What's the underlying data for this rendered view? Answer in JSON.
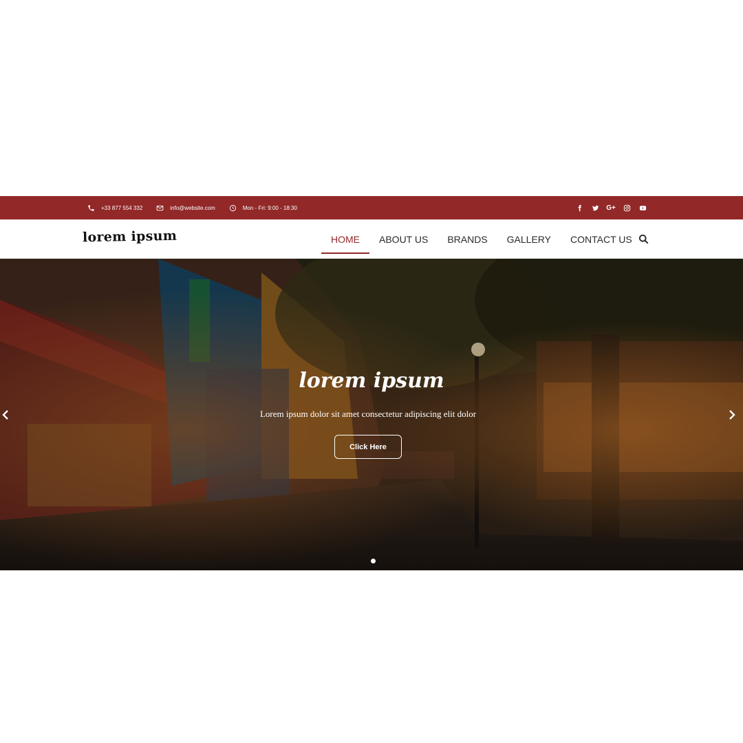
{
  "colors": {
    "brand": "#922828",
    "white": "#ffffff",
    "nav_text": "#2a2a2a"
  },
  "topbar": {
    "phone": {
      "icon": "phone-icon",
      "text": "+33 877 554 332"
    },
    "email": {
      "icon": "envelope-icon",
      "text": "info@website.com"
    },
    "hours": {
      "icon": "clock-icon",
      "text": "Mon - Fri: 9:00 - 18:30"
    },
    "social": [
      "facebook-icon",
      "twitter-icon",
      "google-plus-icon",
      "instagram-icon",
      "youtube-icon"
    ],
    "google_plus_label": "G+"
  },
  "header": {
    "logo": "lorem ipsum",
    "menu": [
      {
        "label": "HOME",
        "active": true
      },
      {
        "label": "ABOUT US",
        "active": false
      },
      {
        "label": "BRANDS",
        "active": false
      },
      {
        "label": "GALLERY",
        "active": false
      },
      {
        "label": "CONTACT US",
        "active": false
      }
    ],
    "search_icon": "search-icon"
  },
  "hero": {
    "title": "lorem ipsum",
    "subtitle": "Lorem ipsum dolor sit amet consectetur adipiscing elit dolor",
    "button": "Click Here",
    "prev_icon": "chevron-left-icon",
    "next_icon": "chevron-right-icon",
    "slides_count": 1,
    "active_slide": 1
  }
}
